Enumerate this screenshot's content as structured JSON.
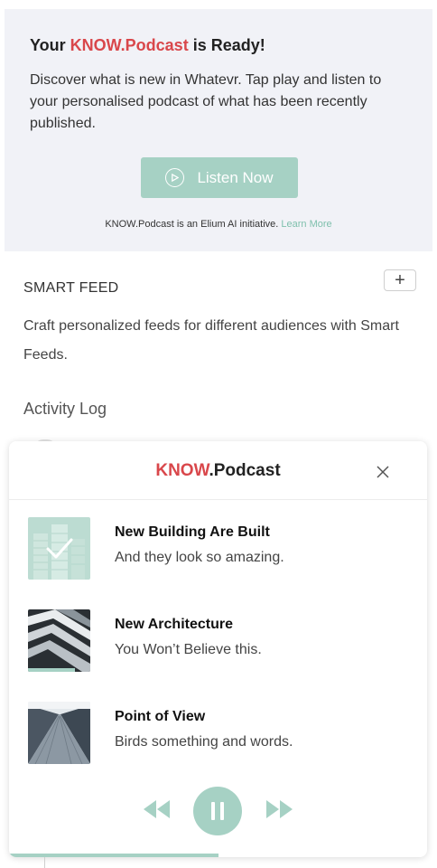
{
  "banner": {
    "title_prefix": "Your ",
    "title_brand": "KNOW.Podcast",
    "title_suffix": " is Ready!",
    "description": "Discover what is new in Whatevr. Tap play and listen to your personalised podcast of what has been recently published.",
    "listen_button": "Listen Now",
    "footnote": "KNOW.Podcast is an Elium AI initiative.",
    "learn_more": "Learn More"
  },
  "smart_feed": {
    "title": "SMART FEED",
    "add_label": "+",
    "description": "Craft personalized feeds for different audiences with Smart Feeds."
  },
  "activity_log": {
    "title": "Activity Log"
  },
  "player": {
    "brand_accent": "KNOW",
    "brand_rest": ".Podcast",
    "close_label": "×",
    "tracks": [
      {
        "title": "New Building Are Built",
        "subtitle": "And they look so amazing.",
        "state": "played",
        "thumb_icon": "checkmark-icon"
      },
      {
        "title": "New Architecture",
        "subtitle": "You Won’t Believe this.",
        "state": "playing",
        "progress": 0.75
      },
      {
        "title": "Point of View",
        "subtitle": "Birds something and words.",
        "state": "queued"
      }
    ],
    "overall_progress": 0.5,
    "controls": {
      "prev": "rewind-icon",
      "pause": "pause-icon",
      "next": "fast-forward-icon"
    }
  },
  "colors": {
    "accent": "#d9474b",
    "mint": "#a6d1c4",
    "banner_bg": "#f1f2f7"
  }
}
